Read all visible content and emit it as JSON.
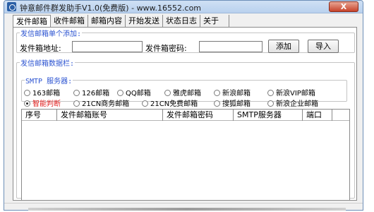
{
  "window": {
    "title": "钟意邮件群发助手V1.0(免费版) - www.16552.com",
    "close_label": "X"
  },
  "tabs": [
    "发件邮箱",
    "收件邮箱",
    "邮箱内容",
    "开始发送",
    "状态日志",
    "关于"
  ],
  "single_add": {
    "legend": "发信邮箱单个添加:",
    "address_label": "发件箱地址:",
    "address_value": "",
    "password_label": "发件箱密码:",
    "password_value": "",
    "add_button": "添加",
    "import_button": "导入"
  },
  "data_section": {
    "legend": "发信邮箱数据栏:",
    "smtp_legend": "SMTP 服务器:",
    "smtp_options": [
      {
        "label": "163邮箱",
        "checked": false
      },
      {
        "label": "126邮箱",
        "checked": false
      },
      {
        "label": "QQ邮箱",
        "checked": false
      },
      {
        "label": "雅虎邮箱",
        "checked": false
      },
      {
        "label": "新浪邮箱",
        "checked": false
      },
      {
        "label": "新浪VIP邮箱",
        "checked": false
      },
      {
        "label": "智能判断",
        "checked": true
      },
      {
        "label": "21CN商务邮箱",
        "checked": false
      },
      {
        "label": "21CN免费邮箱",
        "checked": false
      },
      {
        "label": "搜狐邮箱",
        "checked": false
      },
      {
        "label": "新浪企业邮箱",
        "checked": false
      }
    ],
    "table_headers": [
      "序号",
      "发件邮箱账号",
      "发件邮箱密码",
      "SMTP服务器",
      "端口"
    ]
  },
  "colors": {
    "legend": "#2b53d1",
    "selected_option": "#e0201f",
    "close_button": "#c7432b"
  }
}
